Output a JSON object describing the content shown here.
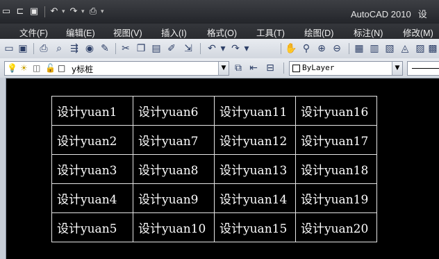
{
  "app": {
    "title": "AutoCAD 2010",
    "title_extra": "设"
  },
  "quick_access": {
    "icons": [
      "new-file-icon",
      "open-folder-icon",
      "save-icon",
      "undo-icon",
      "redo-icon",
      "plot-icon"
    ]
  },
  "menu": {
    "items": [
      "文件(F)",
      "编辑(E)",
      "视图(V)",
      "插入(I)",
      "格式(O)",
      "工具(T)",
      "绘图(D)",
      "标注(N)",
      "修改(M)"
    ]
  },
  "toolbar": {
    "icons": [
      "qnew-icon",
      "save-icon",
      "print-icon",
      "print-preview-icon",
      "publish-icon",
      "3d-dwf-icon",
      "plot-style-icon",
      "cut-icon",
      "copy-icon",
      "paste-icon",
      "match-properties-icon",
      "block-editor-icon",
      "undo-icon",
      "redo-icon",
      "pan-icon",
      "zoom-realtime-icon",
      "zoom-window-icon",
      "zoom-previous-icon",
      "properties-icon",
      "design-center-icon",
      "tool-palettes-icon",
      "sheet-set-icon",
      "markup-icon"
    ]
  },
  "layers": {
    "current_layer": "y标桩",
    "color_value": "ByLayer"
  },
  "table": {
    "rows": [
      [
        "设计yuan1",
        "设计yuan6",
        "设计yuan11",
        "设计yuan16"
      ],
      [
        "设计yuan2",
        "设计yuan7",
        "设计yuan12",
        "设计yuan17"
      ],
      [
        "设计yuan3",
        "设计yuan8",
        "设计yuan13",
        "设计yuan18"
      ],
      [
        "设计yuan4",
        "设计yuan9",
        "设计yuan14",
        "设计yuan19"
      ],
      [
        "设计yuan5",
        "设计yuan10",
        "设计yuan15",
        "设计yuan20"
      ]
    ]
  },
  "colors": {
    "canvas": "#000000",
    "title_bar": "#2e3035",
    "toolbar": "#dde1e7",
    "table_line": "#e6e6e6",
    "table_text": "#ffffff"
  }
}
